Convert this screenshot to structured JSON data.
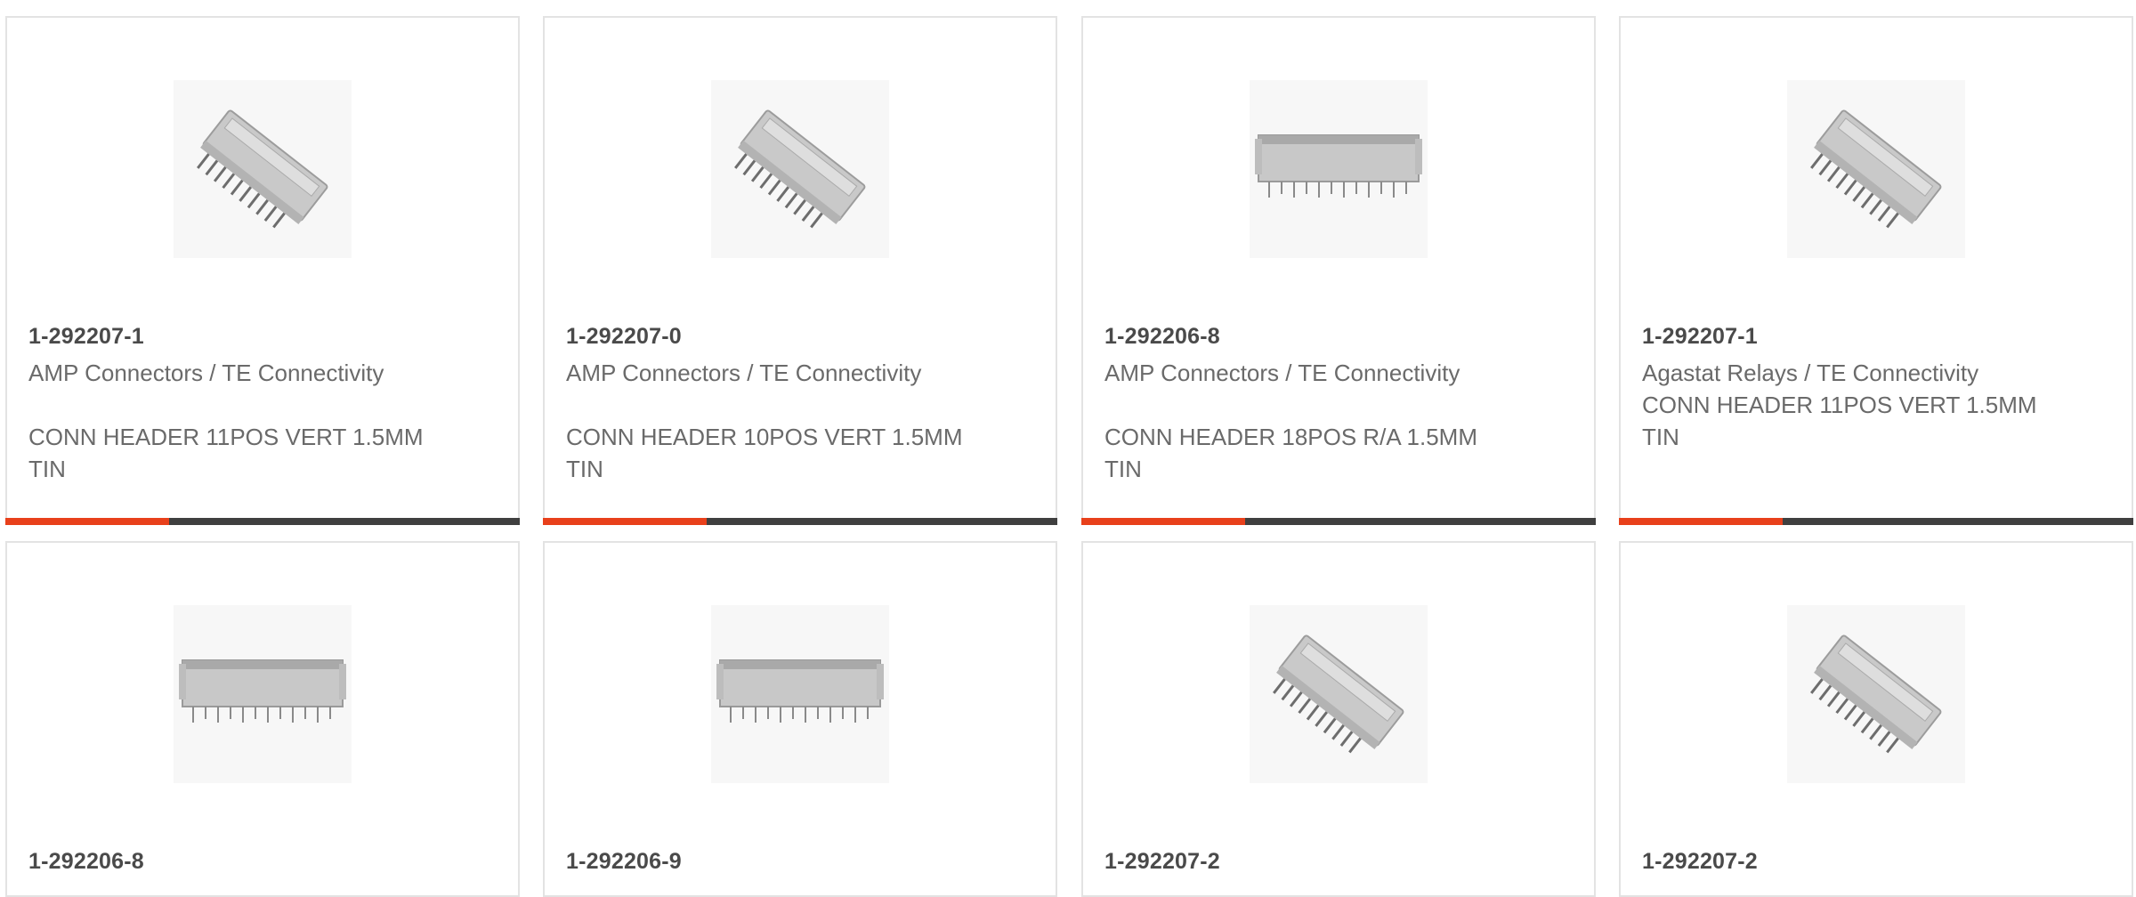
{
  "cards": [
    {
      "part_number": "1-292207-1",
      "manufacturer": "AMP Connectors / TE Connectivity",
      "description": "CONN HEADER 11POS VERT 1.5MM TIN",
      "image_icon": "connector-header-angled-icon"
    },
    {
      "part_number": "1-292207-0",
      "manufacturer": "AMP Connectors / TE Connectivity",
      "description": "CONN HEADER 10POS VERT 1.5MM TIN",
      "image_icon": "connector-header-angled-icon"
    },
    {
      "part_number": "1-292206-8",
      "manufacturer": "AMP Connectors / TE Connectivity",
      "description": "CONN HEADER 18POS R/A 1.5MM TIN",
      "image_icon": "connector-header-flat-icon"
    },
    {
      "part_number": "1-292207-1",
      "manufacturer": "Agastat Relays / TE Connectivity",
      "description": "CONN HEADER 11POS VERT 1.5MM TIN",
      "image_icon": "connector-header-angled-icon"
    },
    {
      "part_number": "1-292206-8",
      "image_icon": "connector-header-flat-icon"
    },
    {
      "part_number": "1-292206-9",
      "image_icon": "connector-header-flat-icon"
    },
    {
      "part_number": "1-292207-2",
      "image_icon": "connector-header-angled-icon"
    },
    {
      "part_number": "1-292207-2",
      "image_icon": "connector-header-angled-icon"
    }
  ],
  "colors": {
    "accent": "#e8401b",
    "bar": "#3f3f3f",
    "border": "#e3e3e3",
    "part_number_text": "#4a4a4a",
    "body_text": "#6a6a6a"
  }
}
